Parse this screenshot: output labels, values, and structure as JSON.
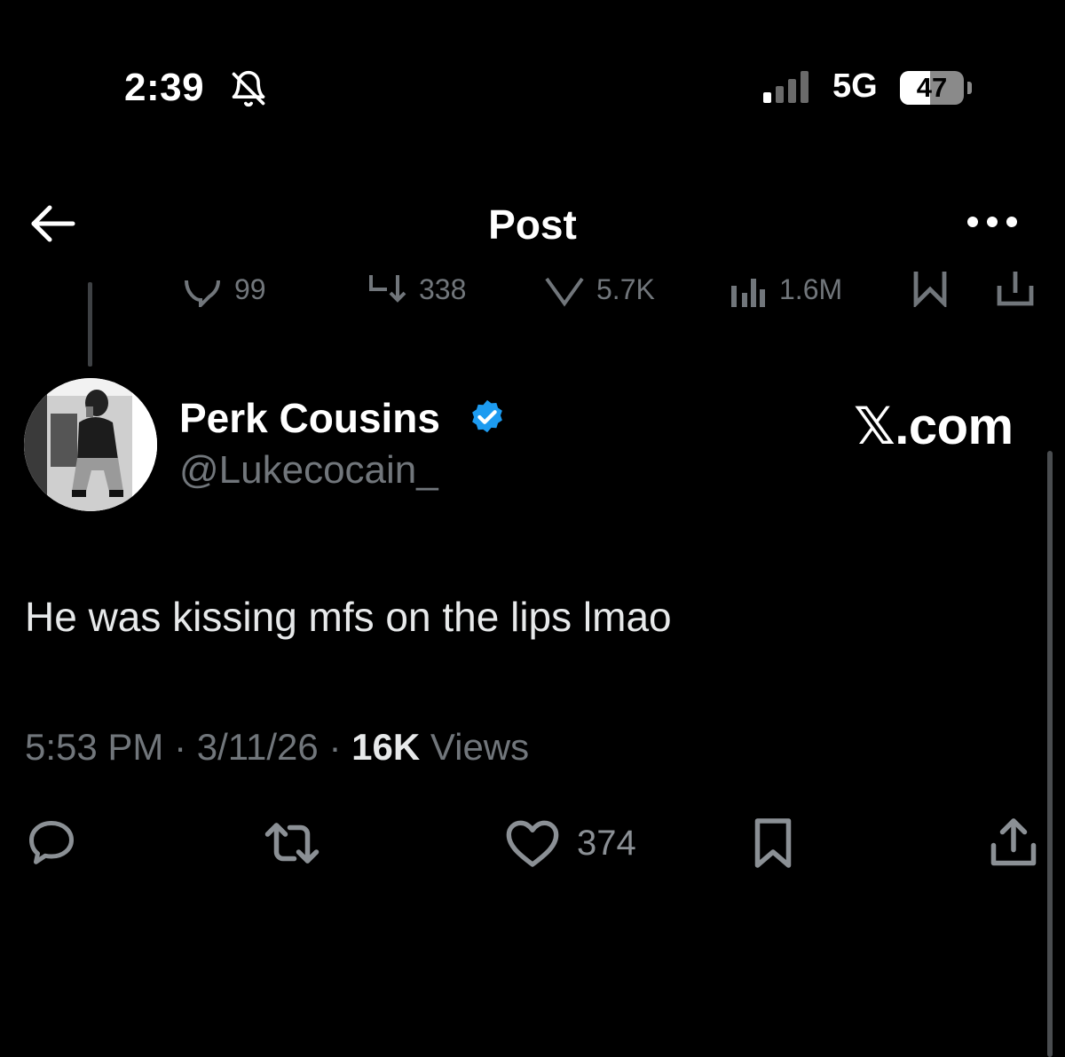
{
  "status_bar": {
    "time": "2:39",
    "network": "5G",
    "battery": "47",
    "battery_level": 0.47,
    "icons": [
      "bell-slash-icon",
      "signal-bars-icon",
      "battery-icon"
    ]
  },
  "header": {
    "title": "Post",
    "icons": [
      "back-arrow-icon",
      "more-dots-icon"
    ]
  },
  "previous_post": {
    "replies": "99",
    "reposts": "338",
    "likes": "5.7K",
    "views": "1.6M"
  },
  "post": {
    "author_name": "Perk Cousins",
    "author_handle": "@Lukecocain_",
    "verified": true,
    "brand": "𝕏.com",
    "text": "He was kissing mfs on the lips lmao",
    "time": "5:53 PM",
    "date": "3/11/26",
    "views_count": "16K",
    "views_label": "Views",
    "sep": "·",
    "likes": "374"
  },
  "colors": {
    "background": "#000000",
    "text_primary": "#e7e9ea",
    "text_secondary": "#71767b",
    "verified_blue": "#1d9bf0"
  }
}
